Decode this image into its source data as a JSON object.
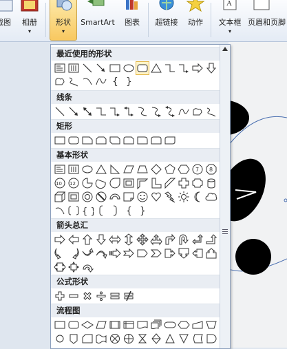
{
  "ribbon": {
    "items": [
      {
        "label": "截图",
        "dropdown": false
      },
      {
        "label": "相册",
        "dropdown": true
      },
      {
        "label": "形状",
        "dropdown": true
      },
      {
        "label": "SmartArt",
        "dropdown": false
      },
      {
        "label": "图表",
        "dropdown": false
      },
      {
        "label": "超链接",
        "dropdown": false
      },
      {
        "label": "动作",
        "dropdown": false
      },
      {
        "label": "文本框",
        "dropdown": true
      },
      {
        "label": "页眉和页脚",
        "dropdown": false
      }
    ],
    "dropdown_glyph": "▾"
  },
  "gallery": {
    "sections": [
      {
        "title": "最近使用的形状"
      },
      {
        "title": "线条"
      },
      {
        "title": "矩形"
      },
      {
        "title": "基本形状"
      },
      {
        "title": "箭头总汇"
      },
      {
        "title": "公式形状"
      },
      {
        "title": "流程图"
      }
    ],
    "selected_shape": "rounded-rectangle"
  },
  "colors": {
    "accent": "#f8c860",
    "panel_border": "#8da0bd",
    "section_header_bg": "#e9edf3"
  }
}
